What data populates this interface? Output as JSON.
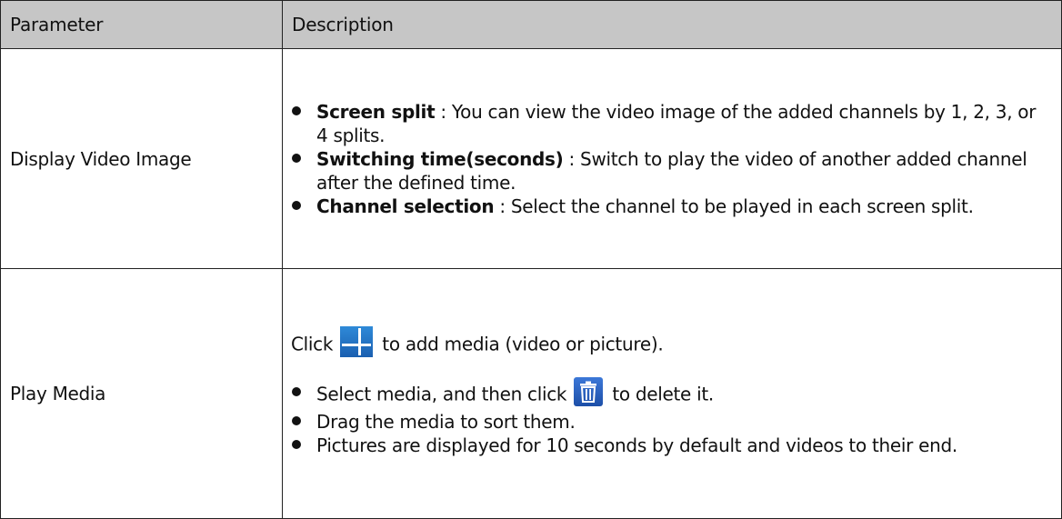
{
  "table": {
    "headers": [
      "Parameter",
      "Description"
    ],
    "rows": [
      {
        "parameter": "Display Video Image",
        "items": [
          {
            "term": "Screen split",
            "text": " : You can view the video image of the added channels by 1, 2, 3, or 4 splits."
          },
          {
            "term": "Switching time(seconds)",
            "text": " : Switch to play the video of another added channel after the defined time."
          },
          {
            "term": "Channel selection",
            "text": " : Select the channel to be played in each screen split."
          }
        ]
      },
      {
        "parameter": "Play Media",
        "intro_before": "Click",
        "intro_after": " to add media (video or picture).",
        "items": [
          {
            "before": "Select media, and then click",
            "after": " to delete it."
          },
          {
            "text": "Drag the media to sort them."
          },
          {
            "text": "Pictures are displayed for 10 seconds by default and videos to their end."
          }
        ]
      }
    ]
  },
  "icons": {
    "add": "plus-icon",
    "delete": "trash-icon",
    "header_background": "#c6c6c6",
    "icon_color": "#1f6fc4"
  }
}
